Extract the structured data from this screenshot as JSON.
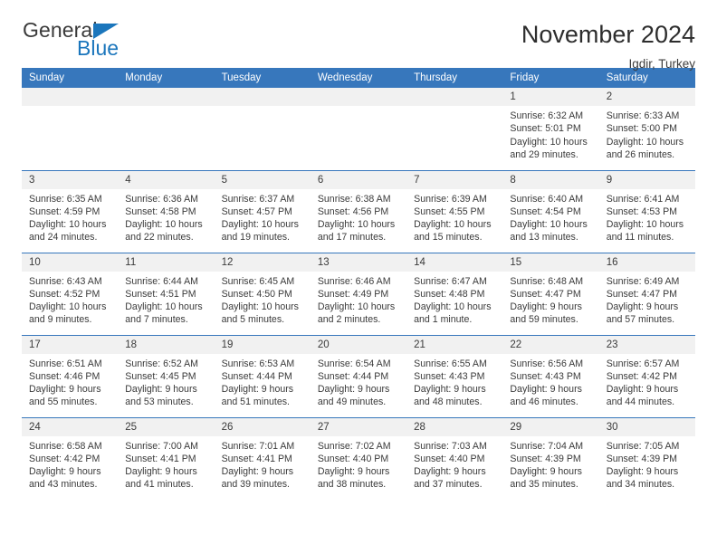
{
  "brand": {
    "word1": "General",
    "word2": "Blue",
    "accent_color": "#1b76bc",
    "triangle_icon": "triangle-icon"
  },
  "header": {
    "title": "November 2024",
    "subtitle": "Igdir, Turkey"
  },
  "weekday_headers": [
    "Sunday",
    "Monday",
    "Tuesday",
    "Wednesday",
    "Thursday",
    "Friday",
    "Saturday"
  ],
  "theme": {
    "header_bg": "#3777bc",
    "daynum_bg": "#f1f1f1",
    "row_border": "#3777bc",
    "text": "#3a3a3a"
  },
  "labels": {
    "sunrise_prefix": "Sunrise:",
    "sunset_prefix": "Sunset:",
    "daylight_prefix": "Daylight:"
  },
  "weeks": [
    [
      {
        "day": "",
        "empty": true
      },
      {
        "day": "",
        "empty": true
      },
      {
        "day": "",
        "empty": true
      },
      {
        "day": "",
        "empty": true
      },
      {
        "day": "",
        "empty": true
      },
      {
        "day": "1",
        "sunrise": "Sunrise: 6:32 AM",
        "sunset": "Sunset: 5:01 PM",
        "daylight": "Daylight: 10 hours and 29 minutes."
      },
      {
        "day": "2",
        "sunrise": "Sunrise: 6:33 AM",
        "sunset": "Sunset: 5:00 PM",
        "daylight": "Daylight: 10 hours and 26 minutes."
      }
    ],
    [
      {
        "day": "3",
        "sunrise": "Sunrise: 6:35 AM",
        "sunset": "Sunset: 4:59 PM",
        "daylight": "Daylight: 10 hours and 24 minutes."
      },
      {
        "day": "4",
        "sunrise": "Sunrise: 6:36 AM",
        "sunset": "Sunset: 4:58 PM",
        "daylight": "Daylight: 10 hours and 22 minutes."
      },
      {
        "day": "5",
        "sunrise": "Sunrise: 6:37 AM",
        "sunset": "Sunset: 4:57 PM",
        "daylight": "Daylight: 10 hours and 19 minutes."
      },
      {
        "day": "6",
        "sunrise": "Sunrise: 6:38 AM",
        "sunset": "Sunset: 4:56 PM",
        "daylight": "Daylight: 10 hours and 17 minutes."
      },
      {
        "day": "7",
        "sunrise": "Sunrise: 6:39 AM",
        "sunset": "Sunset: 4:55 PM",
        "daylight": "Daylight: 10 hours and 15 minutes."
      },
      {
        "day": "8",
        "sunrise": "Sunrise: 6:40 AM",
        "sunset": "Sunset: 4:54 PM",
        "daylight": "Daylight: 10 hours and 13 minutes."
      },
      {
        "day": "9",
        "sunrise": "Sunrise: 6:41 AM",
        "sunset": "Sunset: 4:53 PM",
        "daylight": "Daylight: 10 hours and 11 minutes."
      }
    ],
    [
      {
        "day": "10",
        "sunrise": "Sunrise: 6:43 AM",
        "sunset": "Sunset: 4:52 PM",
        "daylight": "Daylight: 10 hours and 9 minutes."
      },
      {
        "day": "11",
        "sunrise": "Sunrise: 6:44 AM",
        "sunset": "Sunset: 4:51 PM",
        "daylight": "Daylight: 10 hours and 7 minutes."
      },
      {
        "day": "12",
        "sunrise": "Sunrise: 6:45 AM",
        "sunset": "Sunset: 4:50 PM",
        "daylight": "Daylight: 10 hours and 5 minutes."
      },
      {
        "day": "13",
        "sunrise": "Sunrise: 6:46 AM",
        "sunset": "Sunset: 4:49 PM",
        "daylight": "Daylight: 10 hours and 2 minutes."
      },
      {
        "day": "14",
        "sunrise": "Sunrise: 6:47 AM",
        "sunset": "Sunset: 4:48 PM",
        "daylight": "Daylight: 10 hours and 1 minute."
      },
      {
        "day": "15",
        "sunrise": "Sunrise: 6:48 AM",
        "sunset": "Sunset: 4:47 PM",
        "daylight": "Daylight: 9 hours and 59 minutes."
      },
      {
        "day": "16",
        "sunrise": "Sunrise: 6:49 AM",
        "sunset": "Sunset: 4:47 PM",
        "daylight": "Daylight: 9 hours and 57 minutes."
      }
    ],
    [
      {
        "day": "17",
        "sunrise": "Sunrise: 6:51 AM",
        "sunset": "Sunset: 4:46 PM",
        "daylight": "Daylight: 9 hours and 55 minutes."
      },
      {
        "day": "18",
        "sunrise": "Sunrise: 6:52 AM",
        "sunset": "Sunset: 4:45 PM",
        "daylight": "Daylight: 9 hours and 53 minutes."
      },
      {
        "day": "19",
        "sunrise": "Sunrise: 6:53 AM",
        "sunset": "Sunset: 4:44 PM",
        "daylight": "Daylight: 9 hours and 51 minutes."
      },
      {
        "day": "20",
        "sunrise": "Sunrise: 6:54 AM",
        "sunset": "Sunset: 4:44 PM",
        "daylight": "Daylight: 9 hours and 49 minutes."
      },
      {
        "day": "21",
        "sunrise": "Sunrise: 6:55 AM",
        "sunset": "Sunset: 4:43 PM",
        "daylight": "Daylight: 9 hours and 48 minutes."
      },
      {
        "day": "22",
        "sunrise": "Sunrise: 6:56 AM",
        "sunset": "Sunset: 4:43 PM",
        "daylight": "Daylight: 9 hours and 46 minutes."
      },
      {
        "day": "23",
        "sunrise": "Sunrise: 6:57 AM",
        "sunset": "Sunset: 4:42 PM",
        "daylight": "Daylight: 9 hours and 44 minutes."
      }
    ],
    [
      {
        "day": "24",
        "sunrise": "Sunrise: 6:58 AM",
        "sunset": "Sunset: 4:42 PM",
        "daylight": "Daylight: 9 hours and 43 minutes."
      },
      {
        "day": "25",
        "sunrise": "Sunrise: 7:00 AM",
        "sunset": "Sunset: 4:41 PM",
        "daylight": "Daylight: 9 hours and 41 minutes."
      },
      {
        "day": "26",
        "sunrise": "Sunrise: 7:01 AM",
        "sunset": "Sunset: 4:41 PM",
        "daylight": "Daylight: 9 hours and 39 minutes."
      },
      {
        "day": "27",
        "sunrise": "Sunrise: 7:02 AM",
        "sunset": "Sunset: 4:40 PM",
        "daylight": "Daylight: 9 hours and 38 minutes."
      },
      {
        "day": "28",
        "sunrise": "Sunrise: 7:03 AM",
        "sunset": "Sunset: 4:40 PM",
        "daylight": "Daylight: 9 hours and 37 minutes."
      },
      {
        "day": "29",
        "sunrise": "Sunrise: 7:04 AM",
        "sunset": "Sunset: 4:39 PM",
        "daylight": "Daylight: 9 hours and 35 minutes."
      },
      {
        "day": "30",
        "sunrise": "Sunrise: 7:05 AM",
        "sunset": "Sunset: 4:39 PM",
        "daylight": "Daylight: 9 hours and 34 minutes."
      }
    ]
  ]
}
